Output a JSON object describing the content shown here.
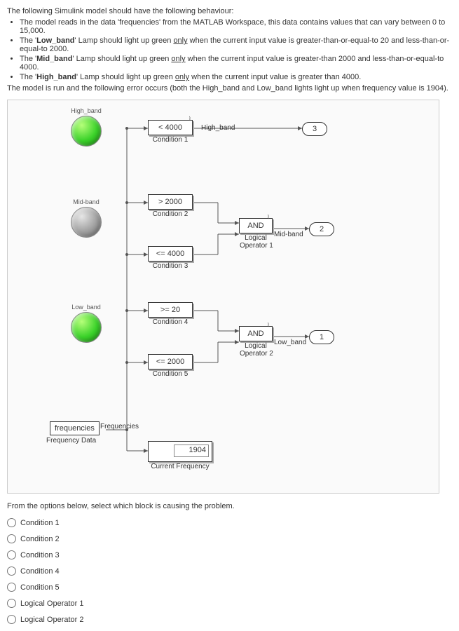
{
  "intro": {
    "lead": "The following Simulink model should have the following behaviour:",
    "bullet1_pre": "The model reads in the data 'frequencies' from the MATLAB Workspace, this data contains values that can vary between 0 to 15,000.",
    "bullet2_pre": "The '",
    "bullet2_name": "Low_band",
    "bullet2_mid": "' Lamp should light up green ",
    "bullet2_only": "only",
    "bullet2_post": " when the current input value is greater-than-or-equal-to 20 and less-than-or-equal-to 2000.",
    "bullet3_pre": "The '",
    "bullet3_name": "Mid_band",
    "bullet3_mid": "' Lamp should light up green ",
    "bullet3_only": "only",
    "bullet3_post": " when the current input value is greater-than 2000 and less-than-or-equal-to 4000.",
    "bullet4_pre": "The '",
    "bullet4_name": "High_band",
    "bullet4_mid": "' Lamp should light up green ",
    "bullet4_only": "only",
    "bullet4_post": " when the current input value is greater than 4000.",
    "run": "The model is run and the following error occurs (both the High_band and Low_band lights light up when frequency value is 1904)."
  },
  "diagram": {
    "lamp_high": "High_band",
    "lamp_mid": "Mid-band",
    "lamp_low": "Low_band",
    "cond1_op": "< 4000",
    "cond1_lbl": "Condition 1",
    "cond1_sig": "High_band",
    "cond2_op": "> 2000",
    "cond2_lbl": "Condition 2",
    "cond3_op": "<= 4000",
    "cond3_lbl": "Condition 3",
    "cond4_op": ">= 20",
    "cond4_lbl": "Condition 4",
    "cond5_op": "<= 2000",
    "cond5_lbl": "Condition 5",
    "and1": "AND",
    "and1_lbl1": "Logical",
    "and1_lbl2": "Operator 1",
    "and1_sig": "Mid-band",
    "and2": "AND",
    "and2_lbl1": "Logical",
    "and2_lbl2": "Operator 2",
    "and2_sig": "Low_band",
    "tag1": "1",
    "tag2": "2",
    "tag3": "3",
    "src_name": "frequencies",
    "src_port": "Frequencies",
    "src_lbl": "Frequency Data",
    "disp_val": "1904",
    "disp_lbl": "Current Frequency"
  },
  "question": {
    "prompt": "From the options below, select which block is causing the problem.",
    "o1": "Condition 1",
    "o2": "Condition 2",
    "o3": "Condition 3",
    "o4": "Condition 4",
    "o5": "Condition 5",
    "o6": "Logical Operator 1",
    "o7": "Logical Operator 2"
  }
}
